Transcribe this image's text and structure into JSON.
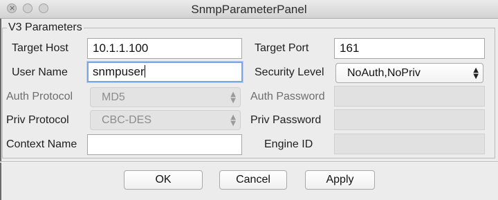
{
  "window": {
    "title": "SnmpParameterPanel"
  },
  "group": {
    "legend": "V3 Parameters"
  },
  "fields": {
    "target_host": {
      "label": "Target Host",
      "value": "10.1.1.100"
    },
    "target_port": {
      "label": "Target Port",
      "value": "161"
    },
    "user_name": {
      "label": "User Name",
      "value": "snmpuser"
    },
    "security_level": {
      "label": "Security Level",
      "value": "NoAuth,NoPriv"
    },
    "auth_protocol": {
      "label": "Auth Protocol",
      "value": "MD5"
    },
    "auth_password": {
      "label": "Auth Password",
      "value": ""
    },
    "priv_protocol": {
      "label": "Priv Protocol",
      "value": "CBC-DES"
    },
    "priv_password": {
      "label": "Priv Password",
      "value": ""
    },
    "context_name": {
      "label": "Context Name",
      "value": ""
    },
    "engine_id": {
      "label": "Engine ID",
      "value": ""
    }
  },
  "buttons": {
    "ok": "OK",
    "cancel": "Cancel",
    "apply": "Apply"
  },
  "icons": {
    "close": "close-icon",
    "updown": "updown-arrows-icon"
  }
}
